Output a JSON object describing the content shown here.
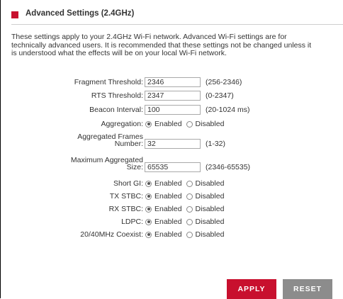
{
  "header": {
    "title": "Advanced Settings (2.4GHz)"
  },
  "description": [
    "These settings apply to your 2.4GHz Wi-Fi network. Advanced Wi-Fi settings are for",
    "technically advanced users. It is recommended that these settings not be changed unless it",
    "is understood what the effects will be on your local Wi-Fi network."
  ],
  "fields": {
    "fragment_threshold": {
      "label": "Fragment Threshold:",
      "value": "2346",
      "hint": "(256-2346)"
    },
    "rts_threshold": {
      "label": "RTS Threshold:",
      "value": "2347",
      "hint": "(0-2347)"
    },
    "beacon_interval": {
      "label": "Beacon Interval:",
      "value": "100",
      "hint": "(20-1024 ms)"
    },
    "aggregated_frames": {
      "label_line1": "Aggregated Frames",
      "label_line2": "Number:",
      "value": "32",
      "hint": "(1-32)"
    },
    "max_aggregated_size": {
      "label_line1": "Maximum Aggregated",
      "label_line2": "Size:",
      "value": "65535",
      "hint": "(2346-65535)"
    }
  },
  "options": {
    "enabled": "Enabled",
    "disabled": "Disabled"
  },
  "radio_settings": {
    "aggregation": {
      "label": "Aggregation:",
      "selected": "Enabled"
    },
    "short_gi": {
      "label": "Short GI:",
      "selected": "Enabled"
    },
    "tx_stbc": {
      "label": "TX STBC:",
      "selected": "Enabled"
    },
    "rx_stbc": {
      "label": "RX STBC:",
      "selected": "Enabled"
    },
    "ldpc": {
      "label": "LDPC:",
      "selected": "Enabled"
    },
    "coexist": {
      "label": "20/40MHz Coexist:",
      "selected": "Enabled"
    }
  },
  "buttons": {
    "apply": "APPLY",
    "reset": "RESET"
  },
  "colors": {
    "accent": "#c8102e",
    "reset": "#8c8c8c"
  }
}
